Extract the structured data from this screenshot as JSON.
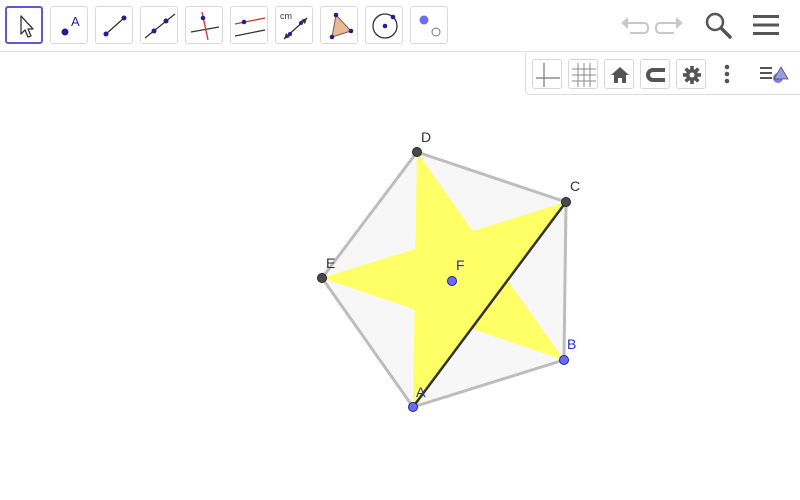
{
  "toolbar": {
    "tools": [
      {
        "name": "move-tool",
        "icon": "arrow-pointer-icon",
        "active": true
      },
      {
        "name": "point-tool",
        "icon": "point-icon",
        "label": "A"
      },
      {
        "name": "segment-tool",
        "icon": "segment-icon"
      },
      {
        "name": "line-tool",
        "icon": "line-icon"
      },
      {
        "name": "perpendicular-line-tool",
        "icon": "perpendicular-line-icon"
      },
      {
        "name": "parallel-line-tool",
        "icon": "parallel-line-icon"
      },
      {
        "name": "distance-tool",
        "icon": "distance-icon",
        "label": "cm"
      },
      {
        "name": "polygon-tool",
        "icon": "polygon-icon"
      },
      {
        "name": "circle-tool",
        "icon": "circle-with-center-icon"
      },
      {
        "name": "slider-tool",
        "icon": "slider-icon"
      }
    ],
    "right": [
      "undo-icon",
      "redo-icon",
      "search-icon",
      "menu-icon"
    ]
  },
  "graphics_bar": [
    "axes-icon",
    "grid-icon",
    "home-icon",
    "snap-magnet-icon",
    "gear-icon",
    "more-vertical-icon",
    "style-bar-toggle-icon"
  ],
  "colors": {
    "accent": "#6557d2",
    "star_fill": "#ffff66",
    "polygon_fill": "#f7f7f7",
    "polygon_stroke": "#bdbdbd",
    "free_point": "#6c6cf5",
    "dependent_point": "#4a4a4a",
    "segment": "#333333"
  },
  "points": {
    "A": {
      "label": "A",
      "type": "free"
    },
    "B": {
      "label": "B",
      "type": "free"
    },
    "C": {
      "label": "C",
      "type": "dependent"
    },
    "D": {
      "label": "D",
      "type": "dependent"
    },
    "E": {
      "label": "E",
      "type": "dependent"
    },
    "F": {
      "label": "F",
      "type": "free"
    }
  }
}
